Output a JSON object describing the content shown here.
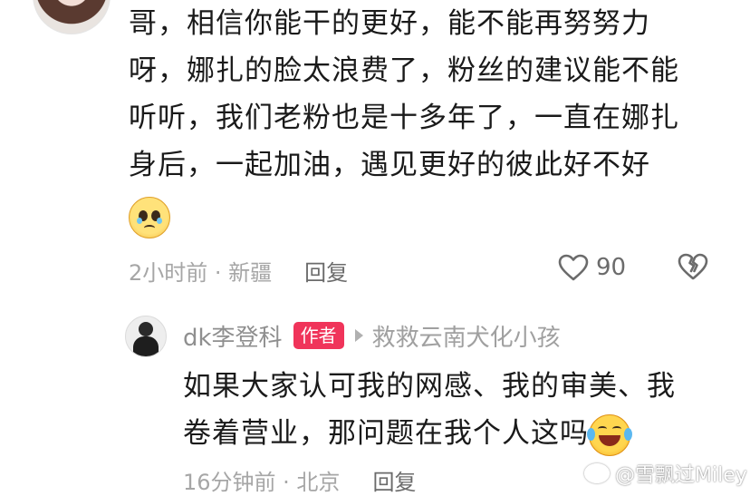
{
  "comment": {
    "lines": [
      "哥，相信你能干的更好，能不能再努努力",
      "呀，娜扎的脸太浪费了，粉丝的建议能不能",
      "听听，我们老粉也是十多年了，一直在娜扎",
      "身后，一起加油，遇见更好的彼此好不好"
    ],
    "emoji_icon": "pleading-face-icon",
    "time_location": "2小时前 · 新疆",
    "reply_label": "回复",
    "like_count": "90"
  },
  "reply": {
    "username": "dk李登科",
    "author_badge": "作者",
    "reply_to": "救救云南犬化小孩",
    "lines": [
      "如果大家认可我的网感、我的审美、我",
      "卷着营业，那问题在我个人这吗"
    ],
    "emoji_icon": "laughing-tears-icon",
    "time_location": "16分钟前 · 北京",
    "reply_label": "回复"
  },
  "watermark": "@雪飘过Miley",
  "colors": {
    "badge": "#f0345a",
    "meta": "#a6a6a6",
    "text": "#1a1a1a"
  }
}
